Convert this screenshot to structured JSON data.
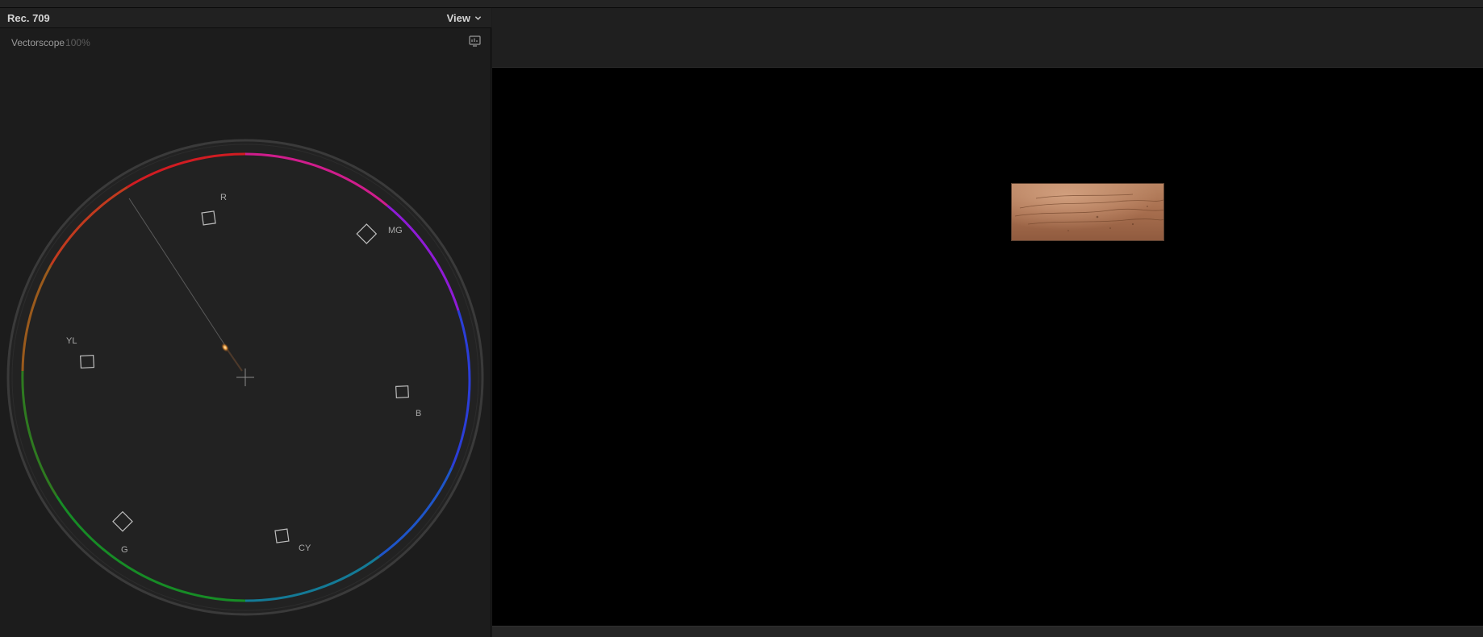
{
  "scope": {
    "color_space": "Rec. 709",
    "view_menu_label": "View",
    "scope_type": "Vectorscope",
    "zoom": "100%",
    "targets": [
      {
        "key": "r",
        "label": "R"
      },
      {
        "key": "mg",
        "label": "MG"
      },
      {
        "key": "b",
        "label": "B"
      },
      {
        "key": "cy",
        "label": "CY"
      },
      {
        "key": "g",
        "label": "G"
      },
      {
        "key": "yl",
        "label": "YL"
      }
    ],
    "ring_colors": {
      "red": "#d11c22",
      "magenta": "#cf1d8c",
      "purple": "#8f1bd6",
      "blue": "#2b3ed8",
      "cyan": "#147a96",
      "green": "#178c26",
      "yellow": "#8c6a1e",
      "orange": "#c1481e"
    }
  },
  "viewer": {
    "clip_icon": "skin-texture-thumbnail"
  }
}
